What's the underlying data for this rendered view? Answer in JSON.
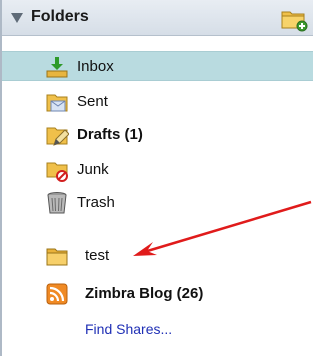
{
  "header": {
    "title": "Folders",
    "toggle_icon": "collapse-triangle-icon",
    "new_folder_icon": "new-folder-icon"
  },
  "folders": [
    {
      "label": "Inbox",
      "icon": "inbox-icon",
      "selected": true
    },
    {
      "label": "Sent",
      "icon": "sent-icon"
    },
    {
      "label": "Drafts (1)",
      "icon": "drafts-icon",
      "bold": true
    },
    {
      "label": "Junk",
      "icon": "junk-icon"
    },
    {
      "label": "Trash",
      "icon": "trash-icon"
    },
    {
      "label": "test",
      "icon": "folder-icon"
    },
    {
      "label": "Zimbra Blog (26)",
      "icon": "rss-feed-icon",
      "bold": true
    }
  ],
  "find_shares": "Find Shares...",
  "colors": {
    "selected_row": "#b9dbe0",
    "folder_yellow": "#f5c84b",
    "link": "#1f2fb5",
    "annotation_arrow": "#e01b1b"
  }
}
